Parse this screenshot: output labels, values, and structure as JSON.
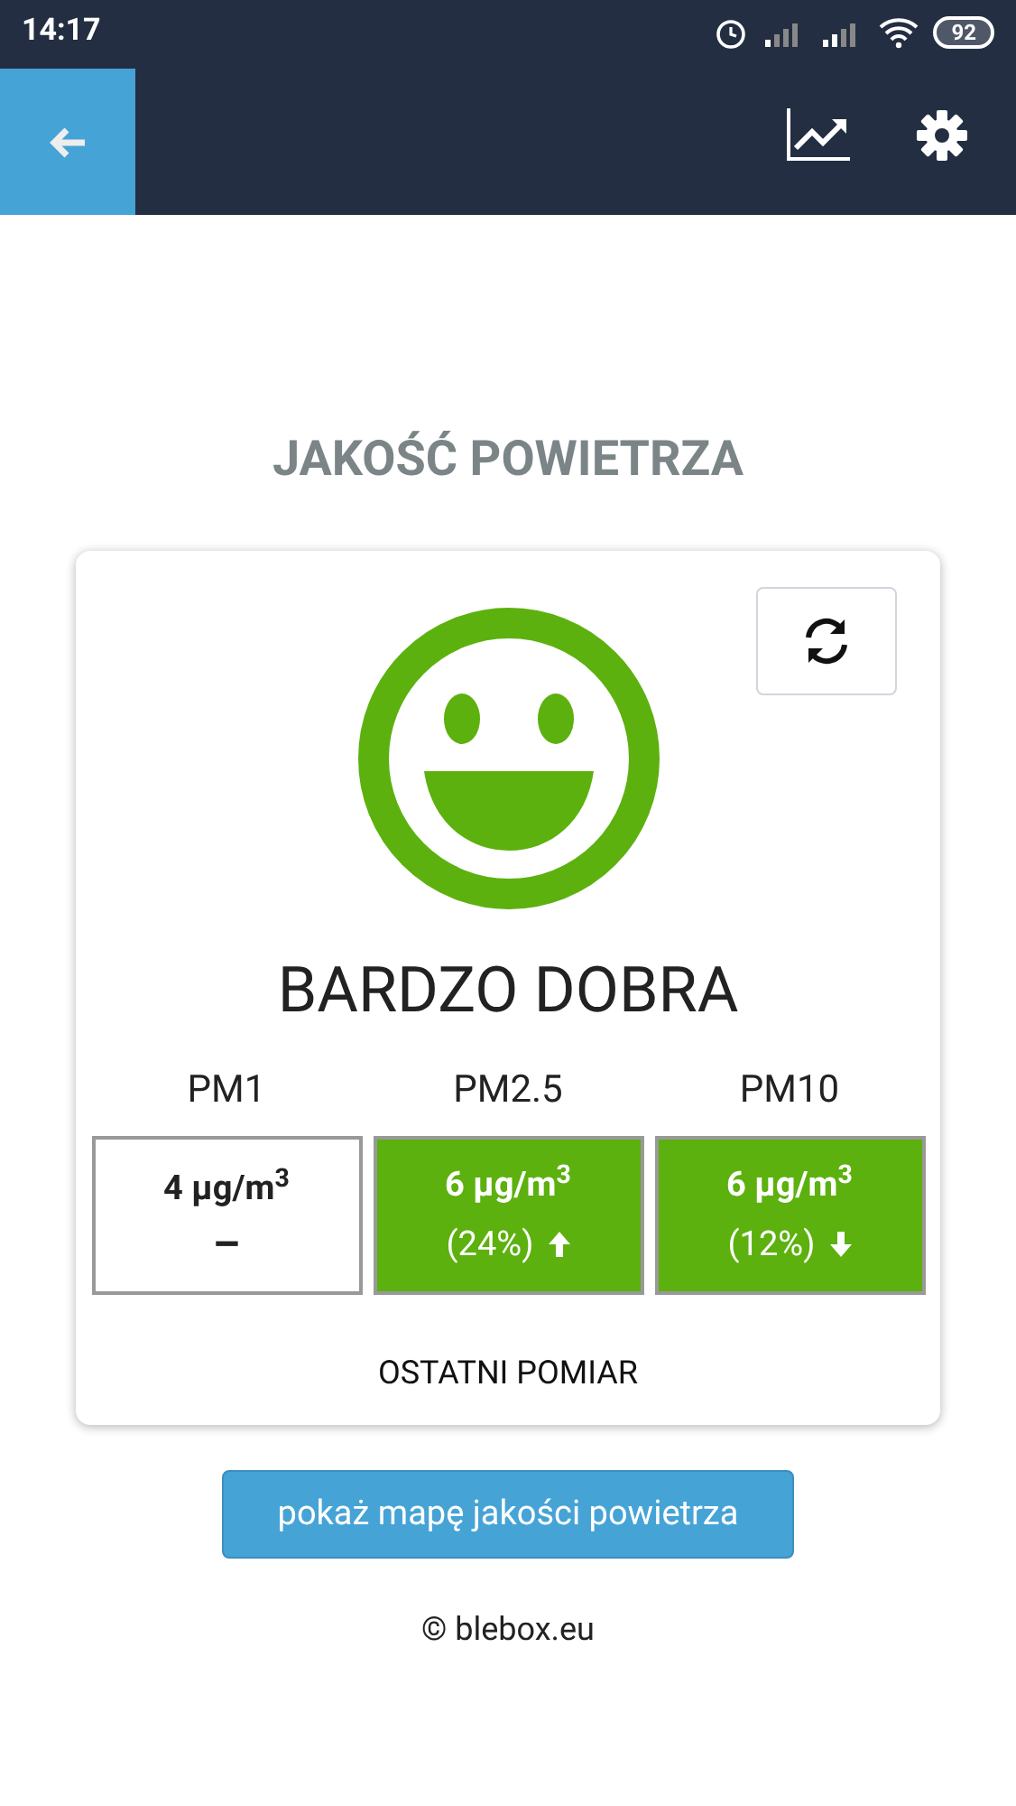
{
  "status_bar": {
    "time": "14:17",
    "battery": "92"
  },
  "title": "JAKOŚĆ POWIETRZA",
  "quality": "BARDZO DOBRA",
  "measurements": [
    {
      "label": "PM1",
      "value": "4 µg/m$^{3}$",
      "kind": "none",
      "change": "–",
      "color": "#ffffff"
    },
    {
      "label": "PM2.5",
      "value": "6 µg/m$^{3}$",
      "kind": "up",
      "change": "(24%)",
      "color": "#5cb10e"
    },
    {
      "label": "PM10",
      "value": "6 µg/m$^{3}$",
      "kind": "down",
      "change": "(12%)",
      "color": "#5cb10e"
    }
  ],
  "last_label": "OSTATNI POMIAR",
  "map_button": "pokaż mapę jakości powietrza",
  "footer": "© blebox.eu"
}
